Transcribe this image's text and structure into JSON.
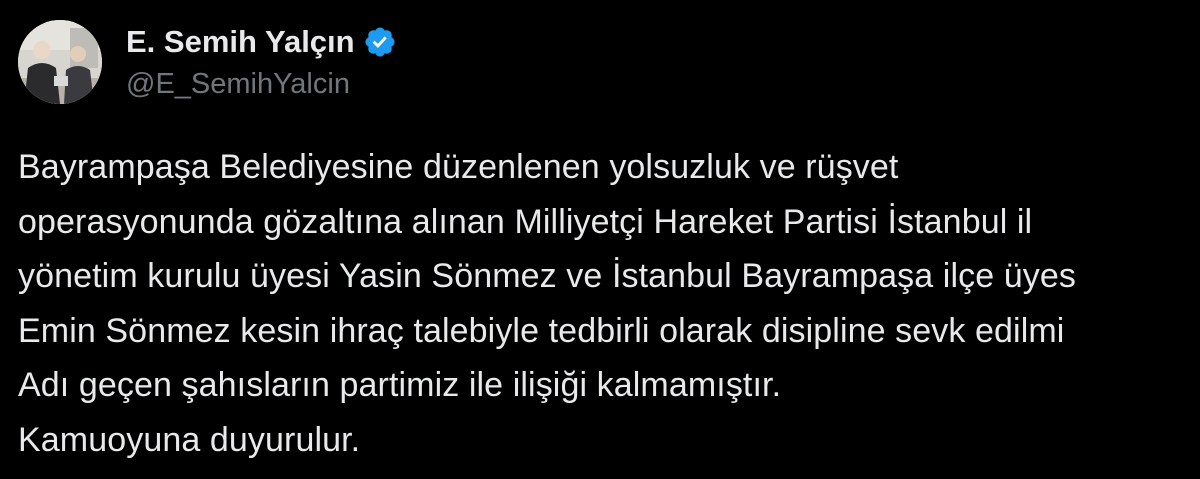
{
  "tweet": {
    "author": {
      "display_name": "E. Semih Yalçın",
      "handle": "@E_SemihYalcin",
      "verified": true,
      "verified_icon": "verified-badge-icon",
      "verified_color": "#1d9bf0"
    },
    "text_lines": [
      "Bayrampaşa Belediyesine düzenlenen yolsuzluk ve rüşvet",
      "operasyonunda gözaltına alınan Milliyetçi Hareket Partisi İstanbul il",
      "yönetim kurulu üyesi Yasin Sönmez ve İstanbul Bayrampaşa ilçe üyes",
      "Emin Sönmez kesin ihraç talebiyle tedbirli olarak disipline sevk edilmi",
      "Adı geçen şahısların partimiz ile ilişiği kalmamıştır.",
      "Kamuoyuna duyurulur."
    ]
  },
  "theme": {
    "background": "#000000",
    "text_color": "#e7e9ea",
    "secondary_text_color": "#71767b"
  }
}
